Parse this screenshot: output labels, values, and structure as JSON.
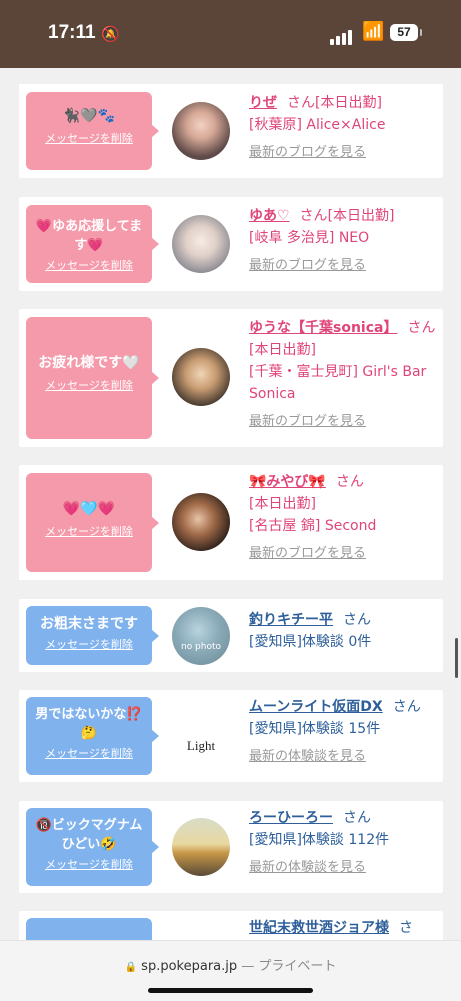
{
  "status": {
    "time": "17:11",
    "battery": "57"
  },
  "cards": [
    {
      "msg": "🐈‍⬛🩶🐾",
      "delete": "メッセージを削除",
      "name": "りぜ",
      "san": "さん",
      "tag": "[本日出勤]",
      "loc": "[秋葉原] Alice×Alice",
      "link": "最新のブログを見る"
    },
    {
      "msg": "💗ゆあ応援してます💗",
      "delete": "メッセージを削除",
      "name": "ゆあ♡",
      "san": "さん",
      "tag": "[本日出勤]",
      "loc": "[岐阜 多治見] NEO",
      "link": "最新のブログを見る"
    },
    {
      "msg": "お疲れ様です🤍",
      "delete": "メッセージを削除",
      "name": "ゆうな【千葉sonica】",
      "san": "さん",
      "tag": "[本日出勤]",
      "loc": "[千葉・富士見町] Girl's Bar Sonica",
      "link": "最新のブログを見る"
    },
    {
      "msg": "💗🩵💗",
      "delete": "メッセージを削除",
      "name": "🎀みやび🎀",
      "san": "さん",
      "tag": "[本日出勤]",
      "loc": "[名古屋 錦] Second",
      "link": "最新のブログを見る"
    },
    {
      "msg": "お粗末さまです",
      "delete": "メッセージを削除",
      "name": "釣りキチー平",
      "san": "さん",
      "tag": "",
      "loc": "[愛知県]体験談 0件",
      "link": "",
      "avatar_text": "no photo"
    },
    {
      "msg": "男ではないかな⁉️🤔",
      "delete": "メッセージを削除",
      "name": "ムーンライト仮面DX",
      "san": "さん",
      "tag": "",
      "loc": "[愛知県]体験談 15件",
      "link": "最新の体験談を見る",
      "avatar_text": "Light"
    },
    {
      "msg": "🔞ビックマグナムひどい🤣",
      "delete": "メッセージを削除",
      "name": "ろーひーろー",
      "san": "さん",
      "tag": "",
      "loc": "[愛知県]体験談 112件",
      "link": "最新の体験談を見る"
    },
    {
      "msg": "",
      "delete": "",
      "name": "世紀末救世酒ジョア様",
      "san": "さ",
      "tag": "",
      "loc": "",
      "link": ""
    }
  ],
  "browser": {
    "host": "sp.pokepara.jp",
    "sep": " — ",
    "private": "プライベート",
    "lock": "🔒"
  },
  "colors": {
    "pink": "#f59aaa",
    "blue": "#80b2ee",
    "status_bar": "#5a4538"
  }
}
